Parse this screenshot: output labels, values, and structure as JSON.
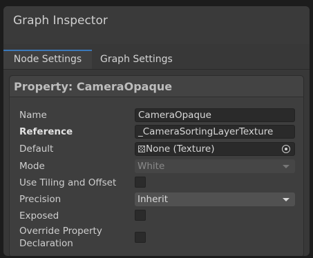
{
  "window": {
    "title": "Graph Inspector"
  },
  "tabs": [
    {
      "label": "Node Settings",
      "active": true
    },
    {
      "label": "Graph Settings",
      "active": false
    }
  ],
  "property": {
    "header": "Property: CameraOpaque",
    "fields": {
      "name": {
        "label": "Name",
        "value": "CameraOpaque"
      },
      "reference": {
        "label": "Reference",
        "value": "_CameraSortingLayerTexture"
      },
      "default": {
        "label": "Default",
        "value": "None (Texture)",
        "icon": "texture-icon"
      },
      "mode": {
        "label": "Mode",
        "value": "White",
        "disabled": true
      },
      "use_tiling": {
        "label": "Use Tiling and Offset",
        "checked": false
      },
      "precision": {
        "label": "Precision",
        "value": "Inherit"
      },
      "exposed": {
        "label": "Exposed",
        "checked": false
      },
      "override": {
        "label_line1": "Override Property",
        "label_line2": "Declaration",
        "checked": false
      }
    }
  },
  "colors": {
    "accent": "#3a79bb",
    "background": "#383838",
    "field_bg": "#2a2a2a"
  }
}
